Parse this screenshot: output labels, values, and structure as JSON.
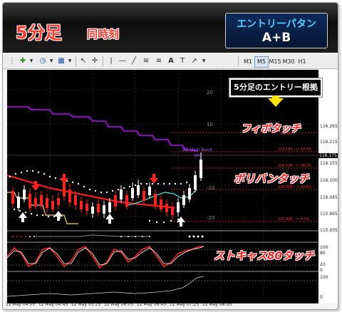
{
  "header": {
    "title": "5分足",
    "subtitle": "同時刻",
    "badge_line1": "エントリーパタン",
    "badge_line2": "A+B"
  },
  "toolbar": {
    "timeframes": [
      "M1",
      "M5",
      "M15",
      "M30",
      "H1"
    ],
    "active_timeframe": "M5"
  },
  "annotations": {
    "callout": "5分足のエントリー根拠",
    "fibo": "フィボタッチ",
    "bollinger": "ボリバンタッチ",
    "stochastic": "ストキャス80タッチ"
  },
  "price_scale": {
    "ticks": [
      "116.265",
      "116.215",
      "116.175",
      "116.155",
      "116.100",
      "116.045",
      "115.995",
      "115.935",
      "100",
      "80",
      "20",
      "0",
      "100",
      "0"
    ],
    "current_price": "116.175"
  },
  "chart_overlay": {
    "fib_labels": [
      "116.181 --> 50.0%",
      "116.128 --> 38.2%",
      "116.069 --> 23.6%",
      "115.999 --> 0.0%",
      "61.8%"
    ],
    "cci_labels": [
      "20",
      "10",
      "-10",
      "-20"
    ],
    "bb_label": "BB Main Band",
    "bb_sub": "SMO"
  },
  "time_axis": [
    "12 May 04:05",
    "12 May 04:45",
    "12 May 05:25",
    "12 May 06:05",
    "12 May 06:45",
    "12 May 07:25",
    "12 May 08:05"
  ],
  "colors": {
    "title_red": "#ff3b2f",
    "badge_cyan": "#4fd0ff",
    "annotation_red": "#ff2020",
    "arrow_yellow": "#ffe600",
    "bb_line": "#c000ff",
    "ma_line": "#ff1a1a",
    "ma_cyan": "#46d3c8",
    "chart_bg": "#000000"
  },
  "icons": [
    "chart-add-icon",
    "clock-icon",
    "template-icon",
    "cursor-icon",
    "crosshair-icon",
    "vertical-line-icon",
    "horizontal-line-icon",
    "trendline-icon",
    "channel-icon",
    "text-icon",
    "label-icon",
    "arrow-tool-icon"
  ]
}
